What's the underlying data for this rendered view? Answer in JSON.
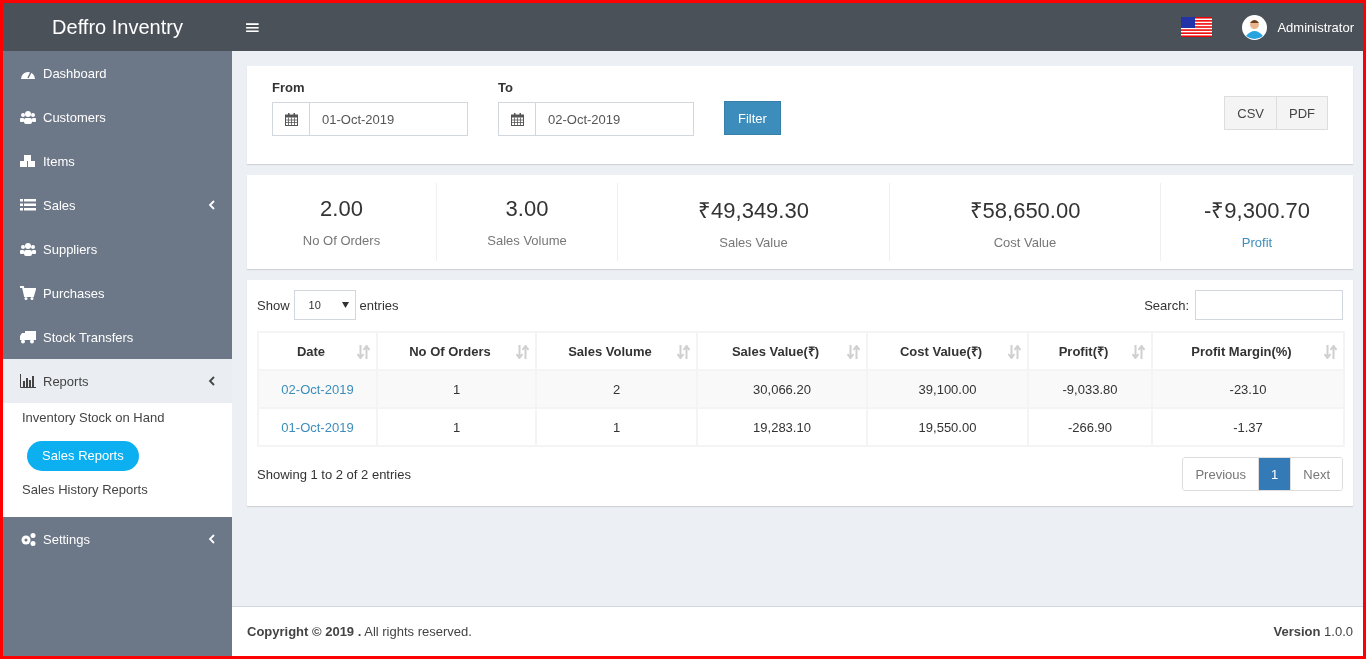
{
  "header": {
    "brand": "Deffro Inventry",
    "menu_glyph": "≡",
    "user_name": "Administrator"
  },
  "sidebar": {
    "items": [
      {
        "label": "Dashboard",
        "kind": "link",
        "selected": false
      },
      {
        "label": "Customers",
        "kind": "link",
        "selected": false
      },
      {
        "label": "Items",
        "kind": "link",
        "selected": false
      },
      {
        "label": "Sales",
        "kind": "tree",
        "selected": false
      },
      {
        "label": "Suppliers",
        "kind": "link",
        "selected": false
      },
      {
        "label": "Purchases",
        "kind": "link",
        "selected": false
      },
      {
        "label": "Stock Transfers",
        "kind": "link",
        "selected": false
      },
      {
        "label": "Reports",
        "kind": "tree",
        "selected": true,
        "children": [
          {
            "label": "Inventory Stock on Hand",
            "selected": false
          },
          {
            "label": "Sales Reports",
            "selected": true
          },
          {
            "label": "Sales History Reports",
            "selected": false
          }
        ]
      },
      {
        "label": "Settings",
        "kind": "tree",
        "selected": false
      }
    ]
  },
  "filter": {
    "from_label": "From",
    "from_value": "01-Oct-2019",
    "to_label": "To",
    "to_value": "02-Oct-2019",
    "button": "Filter",
    "exports": [
      "CSV",
      "PDF"
    ]
  },
  "summary": [
    {
      "value": "2.00",
      "label": "No Of Orders",
      "highlighted": false
    },
    {
      "value": "3.00",
      "label": "Sales Volume",
      "highlighted": false
    },
    {
      "value": "₹49,349.30",
      "label": "Sales Value",
      "highlighted": false
    },
    {
      "value": "₹58,650.00",
      "label": "Cost Value",
      "highlighted": false
    },
    {
      "value": "-₹9,300.70",
      "label": "Profit",
      "highlighted": true
    }
  ],
  "table": {
    "show_label": "Show",
    "page_length": "10",
    "entries_label": "entries",
    "search_label": "Search:",
    "columns": [
      "Date",
      "No Of Orders",
      "Sales Volume",
      "Sales Value(₹)",
      "Cost Value(₹)",
      "Profit(₹)",
      "Profit Margin(%)"
    ],
    "rows": [
      {
        "cells": [
          "02-Oct-2019",
          "1",
          "2",
          "30,066.20",
          "39,100.00",
          "-9,033.80",
          "-23.10"
        ]
      },
      {
        "cells": [
          "01-Oct-2019",
          "1",
          "1",
          "19,283.10",
          "19,550.00",
          "-266.90",
          "-1.37"
        ]
      }
    ],
    "info": "Showing 1 to 2 of 2 entries",
    "pagination": [
      {
        "label": "Previous",
        "selected": false,
        "disabled": true
      },
      {
        "label": "1",
        "selected": true,
        "disabled": false
      },
      {
        "label": "Next",
        "selected": false,
        "disabled": true
      }
    ]
  },
  "footer": {
    "copyright": "**Copyright © 2019 .** All rights reserved.",
    "version": "**Version** 1.0.0"
  }
}
